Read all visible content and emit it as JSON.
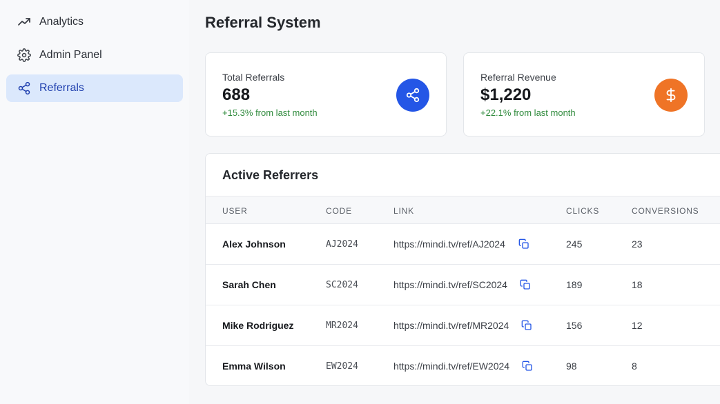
{
  "sidebar": {
    "items": [
      {
        "label": "Analytics",
        "icon": "trending-up-icon",
        "active": false
      },
      {
        "label": "Admin Panel",
        "icon": "gear-icon",
        "active": false
      },
      {
        "label": "Referrals",
        "icon": "share-icon",
        "active": true
      }
    ]
  },
  "page": {
    "title": "Referral System"
  },
  "stats": [
    {
      "label": "Total Referrals",
      "value": "688",
      "delta": "+15.3% from last month",
      "icon": "share-icon",
      "color": "#2456e6"
    },
    {
      "label": "Referral Revenue",
      "value": "$1,220",
      "delta": "+22.1% from last month",
      "icon": "dollar-icon",
      "color": "#ef7426"
    }
  ],
  "table": {
    "title": "Active Referrers",
    "headers": [
      "User",
      "Code",
      "Link",
      "Clicks",
      "Conversions"
    ],
    "rows": [
      {
        "user": "Alex Johnson",
        "code": "AJ2024",
        "link": "https://mindi.tv/ref/AJ2024",
        "clicks": "245",
        "conversions": "23"
      },
      {
        "user": "Sarah Chen",
        "code": "SC2024",
        "link": "https://mindi.tv/ref/SC2024",
        "clicks": "189",
        "conversions": "18"
      },
      {
        "user": "Mike Rodriguez",
        "code": "MR2024",
        "link": "https://mindi.tv/ref/MR2024",
        "clicks": "156",
        "conversions": "12"
      },
      {
        "user": "Emma Wilson",
        "code": "EW2024",
        "link": "https://mindi.tv/ref/EW2024",
        "clicks": "98",
        "conversions": "8"
      }
    ]
  },
  "colors": {
    "accent": "#2456e6",
    "positive": "#2f8a3c",
    "active_nav_bg": "#dbe8fc"
  }
}
